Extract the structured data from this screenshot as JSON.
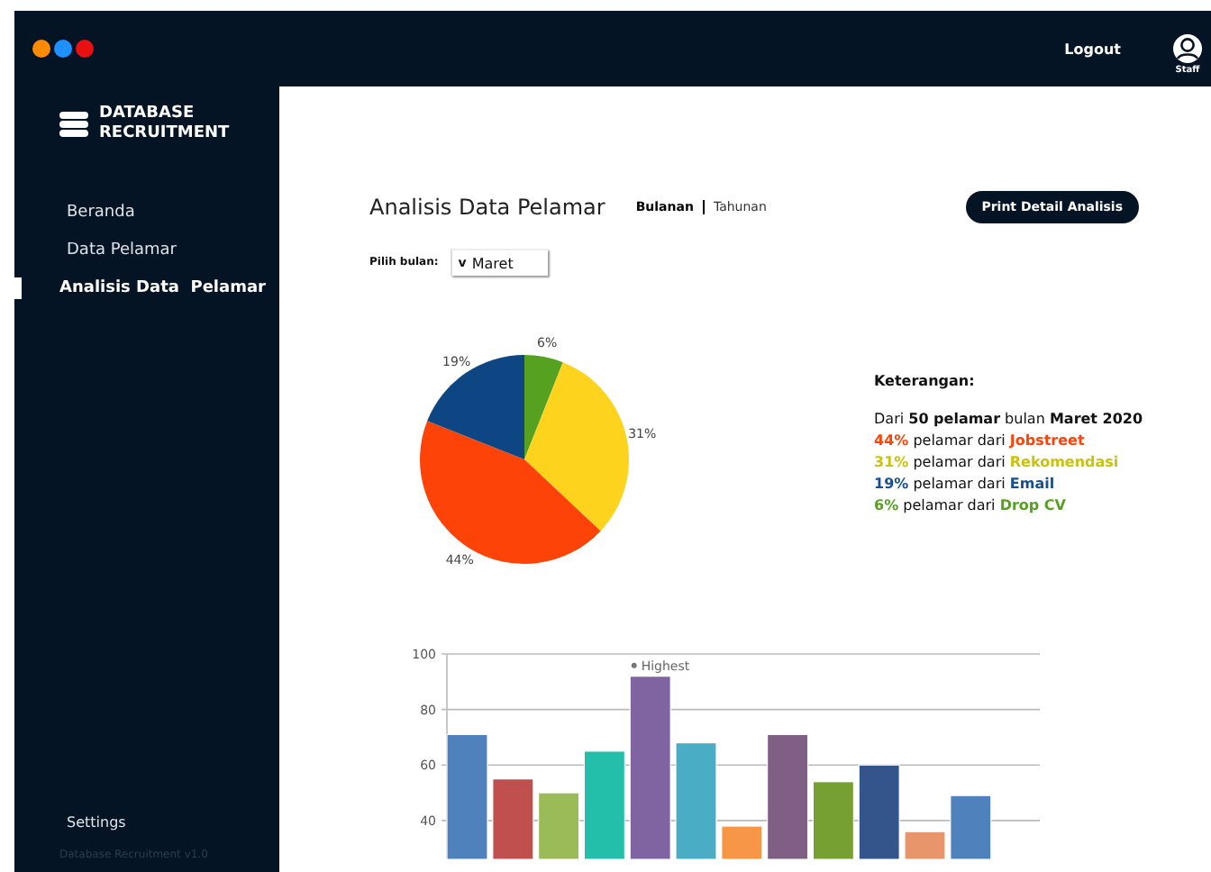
{
  "window": {
    "dots": [
      {
        "color": "#ff8c00"
      },
      {
        "color": "#1e90ff"
      },
      {
        "color": "#e81010"
      }
    ]
  },
  "header": {
    "logout": "Logout",
    "user": "Staff"
  },
  "sidebar": {
    "brand": [
      "DATABASE",
      "RECRUITMENT"
    ],
    "items": [
      {
        "label": "Beranda",
        "selected": false
      },
      {
        "label": "Data Pelamar",
        "selected": false
      },
      {
        "label": "Analisis Data  Pelamar",
        "selected": true
      }
    ],
    "settings": "Settings",
    "version": "Database Recruitment v1.0"
  },
  "page": {
    "title": "Analisis Data Pelamar",
    "tabs": [
      {
        "label": "Bulanan",
        "selected": true
      },
      {
        "label": "Tahunan",
        "selected": false
      }
    ],
    "print_button": "Print Detail Analisis",
    "month_label": "Pilih bulan:",
    "month_caret": "v",
    "month_value": "Maret"
  },
  "pie": {
    "chart_data": {
      "type": "pie",
      "values": [
        6,
        31,
        44,
        19
      ],
      "colors": [
        "#56a11f",
        "#fdd31d",
        "#fd4308",
        "#0d4682"
      ],
      "data_labels": true,
      "value_labels": [
        "6%",
        "31%",
        "44%",
        "19%"
      ]
    }
  },
  "legend": {
    "title": "Keterangan:",
    "summary": "Dari **50 pelamar** bulan **Maret 2020**",
    "items": [
      {
        "percent": "44%",
        "text": "pelamar dari",
        "source": "Jobstreet",
        "color": "#fd4308"
      },
      {
        "percent": "31%",
        "text": "pelamar dari",
        "source": "Rekomendasi",
        "color": "#c9c20e"
      },
      {
        "percent": "19%",
        "text": "pelamar dari",
        "source": "Email",
        "color": "#1a4f8f"
      },
      {
        "percent": "6%",
        "text": "pelamar dari",
        "source": "Drop CV",
        "color": "#56a11f"
      }
    ]
  },
  "bars": {
    "chart_data": {
      "type": "bar",
      "values": [
        71,
        55,
        50,
        65,
        92,
        68,
        38,
        71,
        54,
        60,
        36,
        49
      ],
      "colors": [
        "#4f81bd",
        "#c0504d",
        "#9bbb59",
        "#23bfaa",
        "#8064a2",
        "#4bacc6",
        "#f79646",
        "#7f5f83",
        "#77a033",
        "#34558b",
        "#e8956b",
        "#4f81bd"
      ],
      "ylim": [
        26,
        100
      ],
      "yticks": [
        40,
        60,
        80,
        100
      ],
      "grid": true,
      "annotations": [
        "Highest"
      ]
    }
  }
}
